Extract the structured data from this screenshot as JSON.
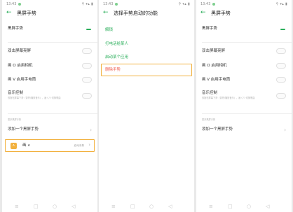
{
  "status_bar": {
    "time": "13:43",
    "icons": "⚲ ▾▴ ▮"
  },
  "settings": {
    "title": "黑屏手势",
    "master_toggle_label": "黑屏手势",
    "items": [
      {
        "label": "双击屏幕亮屏"
      },
      {
        "label": "画 O 启用相机"
      },
      {
        "label": "画 V 启用手电筒"
      },
      {
        "label": "音乐控制",
        "description": "双指在屏幕下滑（暂停/播放音乐），画＜/＞切换歌曲"
      }
    ],
    "section_label": "更多黑屏手势",
    "add_label": "添加一个黑屏手势",
    "custom_gesture": {
      "badge": "∧",
      "name": "画 ∧",
      "action": "启动手势"
    }
  },
  "chooser": {
    "title": "选择手势启动的功能",
    "options": [
      "解锁",
      "打电话给某人",
      "启动某个应用"
    ],
    "delete_label": "删除手势"
  },
  "nav_icons": {
    "back": "◁",
    "home": "○",
    "recents": "□",
    "menu": "≡"
  },
  "colors": {
    "accent": "#2aae5a",
    "highlight": "#f2b13f",
    "danger": "#ef5a4b"
  }
}
